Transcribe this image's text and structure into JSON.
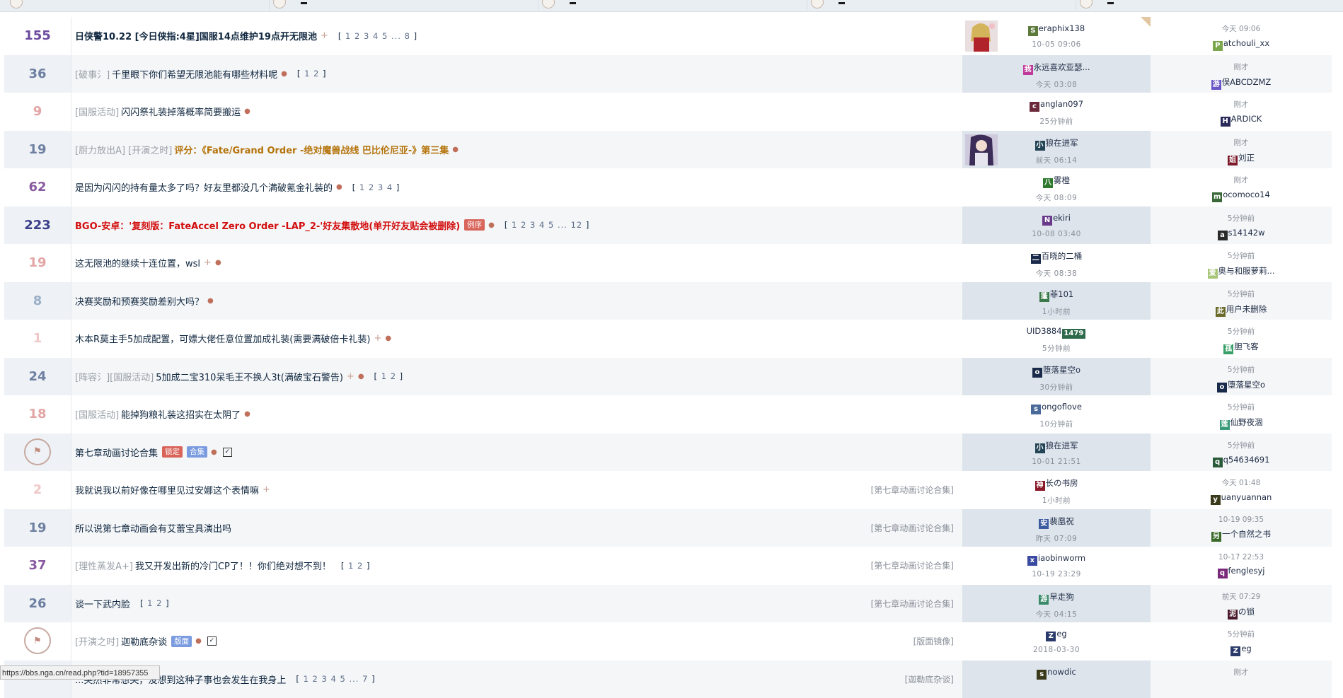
{
  "status_url": "https://bbs.nga.cn/read.php?tid=18957355",
  "rows": [
    {
      "count": "155",
      "count_color": "#6b4aa0",
      "prefix": "",
      "title": "日侠警10.22 [今日侠指:4星]国服14点维护19点开无限池",
      "title_style": "t-bold",
      "plus": "+",
      "dot": "",
      "badges": [],
      "checkbox": false,
      "pages": [
        "1",
        "2",
        "3",
        "4",
        "5",
        "...",
        "8"
      ],
      "source": "",
      "author": "eraphix138",
      "author_icon": "S",
      "author_icon_color": "#5b7a3c",
      "author_time": "10-05 09:06",
      "last_time": "今天 09:06",
      "last_user": "atchouli_xx",
      "last_icon": "P",
      "last_icon_color": "#7ba74c",
      "thumb": "anime-girl-red",
      "corner": true,
      "stripe": "odd"
    },
    {
      "count": "36",
      "count_color": "#6e80a2",
      "prefix": "[破事氵]",
      "title": "千里眼下你们希望无限池能有哪些材料呢",
      "title_style": "t-normal",
      "plus": "",
      "dot": "●",
      "badges": [],
      "checkbox": false,
      "pages": [
        "1",
        "2"
      ],
      "source": "",
      "author": "永远喜欢亚瑟...",
      "author_icon": "我",
      "author_icon_color": "#c03a9a",
      "author_time": "今天 03:08",
      "last_time": "刚才",
      "last_user": "俣ABCDZMZ",
      "last_icon": "游",
      "last_icon_color": "#6a55c7",
      "thumb": "",
      "corner": false,
      "stripe": "even"
    },
    {
      "count": "9",
      "count_color": "#e3a5a5",
      "prefix": "[国服活动]",
      "title": "闪闪祭礼装掉落概率简要搬运",
      "title_style": "t-normal",
      "plus": "",
      "dot": "●",
      "badges": [],
      "checkbox": false,
      "pages": [],
      "source": "",
      "author": "anglan097",
      "author_icon": "c",
      "author_icon_color": "#6b2a3a",
      "author_time": "25分钟前",
      "last_time": "刚才",
      "last_user": "ARDICK",
      "last_icon": "H",
      "last_icon_color": "#2a2a5a",
      "thumb": "",
      "corner": false,
      "stripe": "odd"
    },
    {
      "count": "19",
      "count_color": "#6e80a2",
      "prefix": "[厨力放出A] [开演之时]",
      "title": "评分：《Fate/Grand Order -绝对魔兽战线 巴比伦尼亚-》第三集",
      "title_style": "t-orange",
      "plus": "",
      "dot": "●",
      "badges": [],
      "checkbox": false,
      "pages": [],
      "source": "",
      "author": "狼在进军",
      "author_icon": "小",
      "author_icon_color": "#224455",
      "author_time": "前天 06:14",
      "last_time": "刚才",
      "last_user": "刘正",
      "last_icon": "姐",
      "last_icon_color": "#7a1a2a",
      "thumb": "anime-girl-purple",
      "corner": false,
      "stripe": "even"
    },
    {
      "count": "62",
      "count_color": "#8a5aa0",
      "prefix": "",
      "title": "是因为闪闪的持有量太多了吗？好友里都没几个满破氪金礼装的",
      "title_style": "t-normal",
      "plus": "",
      "dot": "●",
      "badges": [],
      "checkbox": false,
      "pages": [
        "1",
        "2",
        "3",
        "4"
      ],
      "source": "",
      "author": "雾橙",
      "author_icon": "八",
      "author_icon_color": "#2f7a2f",
      "author_time": "今天 08:09",
      "last_time": "刚才",
      "last_user": "ocomoco14",
      "last_icon": "m",
      "last_icon_color": "#3a6a3a",
      "thumb": "",
      "corner": false,
      "stripe": "odd"
    },
    {
      "count": "223",
      "count_color": "#3a3f8a",
      "prefix": "",
      "title": "BGO-安卓：'复刻版：FateAccel Zero Order -LAP_2-'好友集散地(单开好友贴会被删除)",
      "title_style": "t-red",
      "plus": "",
      "dot": "●",
      "badges": [
        {
          "label": "例序",
          "color": "#d9645a"
        }
      ],
      "checkbox": false,
      "pages": [
        "1",
        "2",
        "3",
        "4",
        "5",
        "...",
        "12"
      ],
      "source": "",
      "author": "ekiri",
      "author_icon": "N",
      "author_icon_color": "#6a3a8a",
      "author_time": "10-08 03:40",
      "last_time": "5分钟前",
      "last_user": "s14142w",
      "last_icon": "a",
      "last_icon_color": "#2a2a2a",
      "thumb": "",
      "corner": false,
      "stripe": "even"
    },
    {
      "count": "19",
      "count_color": "#e3a5a5",
      "prefix": "",
      "title": "这无限池的继续十连位置，wsl",
      "title_style": "t-normal",
      "plus": "+",
      "dot": "●",
      "badges": [],
      "checkbox": false,
      "pages": [],
      "source": "",
      "author": "百晓的二桶",
      "author_icon": "二",
      "author_icon_color": "#1a2a4a",
      "author_time": "今天 08:38",
      "last_time": "5分钟前",
      "last_user": "奥与和服萝莉...",
      "last_icon": "爱",
      "last_icon_color": "#a8c57a",
      "thumb": "",
      "corner": false,
      "stripe": "odd"
    },
    {
      "count": "8",
      "count_color": "#9ab0c8",
      "prefix": "",
      "title": "决赛奖励和预赛奖励差别大吗？",
      "title_style": "t-normal",
      "plus": "",
      "dot": "●",
      "badges": [],
      "checkbox": false,
      "pages": [],
      "source": "",
      "author": "菲101",
      "author_icon": "蓬",
      "author_icon_color": "#3a7a4a",
      "author_time": "1小时前",
      "last_time": "5分钟前",
      "last_user": "用户未删除",
      "last_icon": "此",
      "last_icon_color": "#6a6a2a",
      "thumb": "",
      "corner": false,
      "stripe": "even"
    },
    {
      "count": "1",
      "count_color": "#f0c8c8",
      "prefix": "",
      "title": "木本R莫主手5加成配置，可嫖大佬任意位置加成礼装(需要满破倍卡礼装)",
      "title_style": "t-normal",
      "plus": "+",
      "dot": "●",
      "badges": [],
      "checkbox": false,
      "pages": [],
      "source": "",
      "author": "UID3884",
      "author_icon": "",
      "author_icon_color": "",
      "author_time": "5分钟前",
      "author_badge": "1479",
      "last_time": "5分钟前",
      "last_user": "胆飞客",
      "last_icon": "孤",
      "last_icon_color": "#3aa06a",
      "thumb": "",
      "corner": false,
      "stripe": "odd"
    },
    {
      "count": "24",
      "count_color": "#6e80a2",
      "prefix": "[阵容氵][国服活动]",
      "title": "5加成二宝310呆毛王不换人3t(满破宝石警告)",
      "title_style": "t-normal",
      "plus": "+",
      "dot": "●",
      "badges": [],
      "checkbox": false,
      "pages": [
        "1",
        "2"
      ],
      "source": "",
      "author": "堕落星空o",
      "author_icon": "o",
      "author_icon_color": "#1a2a4a",
      "author_time": "30分钟前",
      "last_time": "5分钟前",
      "last_user": "堕落星空o",
      "last_icon": "o",
      "last_icon_color": "#1a2a4a",
      "thumb": "",
      "corner": false,
      "stripe": "even"
    },
    {
      "count": "18",
      "count_color": "#e3a5a5",
      "prefix": "[国服活动]",
      "title": "能掉狗粮礼装这招实在太阴了",
      "title_style": "t-normal",
      "plus": "",
      "dot": "●",
      "badges": [],
      "checkbox": false,
      "pages": [],
      "source": "",
      "author": "ongoflove",
      "author_icon": "s",
      "author_icon_color": "#4a6a9a",
      "author_time": "10分钟前",
      "last_time": "5分钟前",
      "last_user": "仙野夜涸",
      "last_icon": "莲",
      "last_icon_color": "#3a9a7a",
      "thumb": "",
      "corner": false,
      "stripe": "odd"
    },
    {
      "count": "",
      "count_color": "#c28b80",
      "prefix": "",
      "title": "第七章动画讨论合集",
      "title_style": "t-normal",
      "plus": "",
      "dot": "●",
      "badges": [
        {
          "label": "锁定",
          "color": "#d9645a"
        },
        {
          "label": "合集",
          "color": "#7a9be0"
        }
      ],
      "checkbox": true,
      "pages": [],
      "source": "",
      "author": "狼在进军",
      "author_icon": "小",
      "author_icon_color": "#224455",
      "author_time": "10-01 21:51",
      "last_time": "5分钟前",
      "last_user": "q54634691",
      "last_icon": "q",
      "last_icon_color": "#2a5a3a",
      "thumb": "seal",
      "corner": false,
      "stripe": "even",
      "mark": true
    },
    {
      "count": "2",
      "count_color": "#f0c8c8",
      "prefix": "",
      "title": "我就说我以前好像在哪里见过安娜这个表情嘛",
      "title_style": "t-normal",
      "plus": "+",
      "dot": "",
      "badges": [],
      "checkbox": false,
      "pages": [],
      "source": "[第七章动画讨论合集]",
      "author": "长の书房",
      "author_icon": "神",
      "author_icon_color": "#8a1a2a",
      "author_time": "1小时前",
      "last_time": "今天 01:48",
      "last_user": "uanyuannan",
      "last_icon": "y",
      "last_icon_color": "#3a3a1a",
      "thumb": "",
      "corner": false,
      "stripe": "odd",
      "sub": true
    },
    {
      "count": "19",
      "count_color": "#6e80a2",
      "prefix": "",
      "title": "所以说第七章动画会有艾蕾宝具演出吗",
      "title_style": "t-normal",
      "plus": "",
      "dot": "",
      "badges": [],
      "checkbox": false,
      "pages": [],
      "source": "[第七章动画讨论合集]",
      "author": "裴凰祝",
      "author_icon": "安",
      "author_icon_color": "#3a5aa0",
      "author_time": "昨天 07:09",
      "last_time": "10-19 09:35",
      "last_user": "一个自然之书",
      "last_icon": "另",
      "last_icon_color": "#3a6a2a",
      "thumb": "",
      "corner": false,
      "stripe": "even",
      "sub": true
    },
    {
      "count": "37",
      "count_color": "#8a5aa0",
      "prefix": "[理性蒸发A+]",
      "title": "我又开发出新的冷门CP了！！你们绝对想不到！",
      "title_style": "t-normal",
      "plus": "",
      "dot": "",
      "badges": [],
      "checkbox": false,
      "pages": [
        "1",
        "2"
      ],
      "source": "[第七章动画讨论合集]",
      "author": "iaobinworm",
      "author_icon": "x",
      "author_icon_color": "#3a4aa0",
      "author_time": "10-19 23:29",
      "last_time": "10-17 22:53",
      "last_user": "fenglesyj",
      "last_icon": "q",
      "last_icon_color": "#7a2a7a",
      "thumb": "",
      "corner": false,
      "stripe": "odd",
      "sub": true
    },
    {
      "count": "26",
      "count_color": "#6e80a2",
      "prefix": "",
      "title": "谈一下武内脸",
      "title_style": "t-normal",
      "plus": "",
      "dot": "",
      "badges": [],
      "checkbox": false,
      "pages": [
        "1",
        "2"
      ],
      "source": "[第七章动画讨论合集]",
      "author": "早走狗",
      "author_icon": "游",
      "author_icon_color": "#3a8a6a",
      "author_time": "今天 04:15",
      "last_time": "前天 07:29",
      "last_user": "の锁",
      "last_icon": "泥",
      "last_icon_color": "#4a1a2a",
      "thumb": "",
      "corner": false,
      "stripe": "even",
      "sub": true
    },
    {
      "count": "",
      "count_color": "#c28b80",
      "prefix": "[开演之时]",
      "title": "迦勒底杂谈",
      "title_style": "t-normal",
      "plus": "",
      "dot": "●",
      "badges": [
        {
          "label": "版面",
          "color": "#7a9be0"
        }
      ],
      "checkbox": true,
      "pages": [],
      "source": "[版面镜像]",
      "author": "eg",
      "author_icon": "Z",
      "author_icon_color": "#2a3a6a",
      "author_time": "2018-03-30",
      "last_time": "5分钟前",
      "last_user": "eg",
      "last_icon": "Z",
      "last_icon_color": "#2a3a6a",
      "thumb": "seal",
      "corner": false,
      "stripe": "odd"
    },
    {
      "count": "",
      "count_color": "#c28b80",
      "prefix": "",
      "title": "...突然非常想哭，没想到这种子事也会发生在我身上",
      "title_style": "t-normal",
      "plus": "",
      "dot": "",
      "badges": [],
      "checkbox": false,
      "pages": [
        "1",
        "2",
        "3",
        "4",
        "5",
        "...",
        "7"
      ],
      "source": "[迦勒底杂谈]",
      "author": "nowdic",
      "author_icon": "s",
      "author_icon_color": "#3a3a1a",
      "author_time": "",
      "last_time": "刚才",
      "last_user": "",
      "last_icon": "",
      "last_icon_color": "",
      "thumb": "",
      "corner": false,
      "stripe": "even",
      "sub": true
    }
  ]
}
